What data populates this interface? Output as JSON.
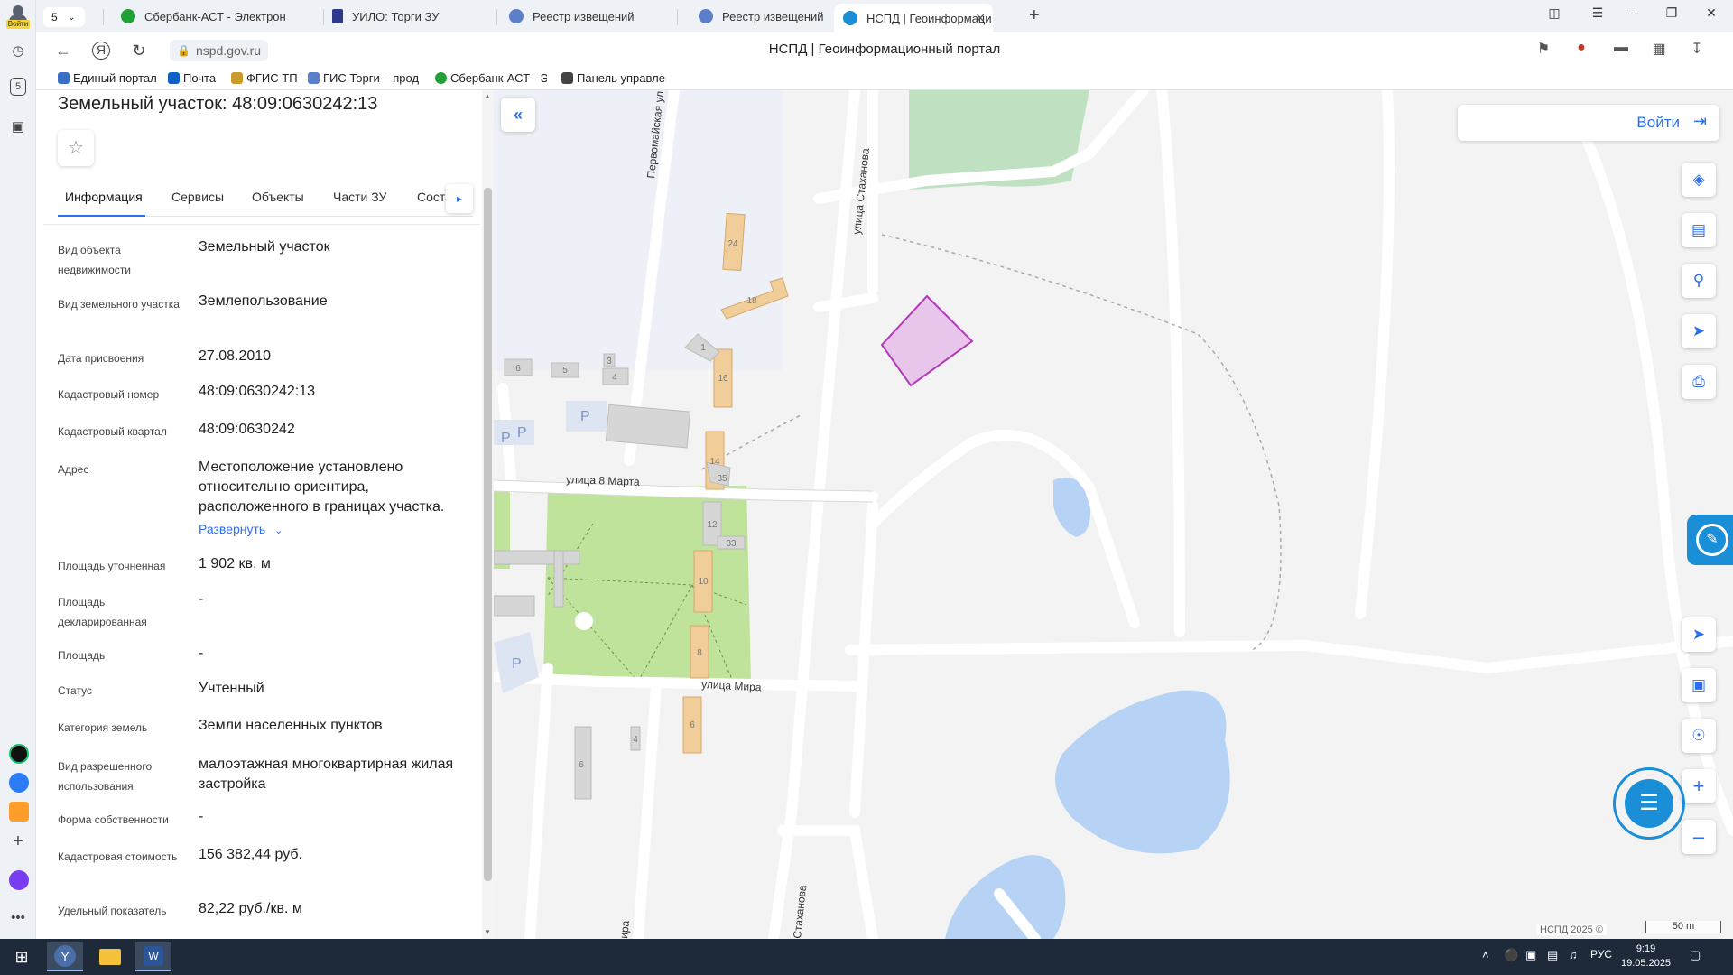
{
  "browser": {
    "profile_badge": "Войти",
    "tab_count": "5",
    "tabs": [
      {
        "title": "Сбербанк-АСТ - Электрон"
      },
      {
        "title": "УИЛО: Торги ЗУ"
      },
      {
        "title": "Реестр извещений"
      },
      {
        "title": "Реестр извещений"
      },
      {
        "title": "НСПД | Геоинформаци"
      }
    ],
    "url": "nspd.gov.ru",
    "page_title": "НСПД | Геоинформационный портал",
    "bookmarks": [
      {
        "label": "Единый портал"
      },
      {
        "label": "Почта"
      },
      {
        "label": "ФГИС ТП"
      },
      {
        "label": "ГИС Торги – прод"
      },
      {
        "label": "Сбербанк-АСТ - Э"
      },
      {
        "label": "Панель управлен"
      }
    ],
    "sidebar_counter": "5"
  },
  "panel": {
    "title": "Земельный участок: 48:09:0630242:13",
    "tabs": [
      "Информация",
      "Сервисы",
      "Объекты",
      "Части ЗУ",
      "Соста"
    ],
    "rows": [
      {
        "label": "Вид объекта недвижимости",
        "value": "Земельный участок"
      },
      {
        "label": "Вид земельного участка",
        "value": "Землепользование"
      },
      {
        "label": "Дата присвоения",
        "value": "27.08.2010"
      },
      {
        "label": "Кадастровый номер",
        "value": "48:09:0630242:13"
      },
      {
        "label": "Кадастровый квартал",
        "value": "48:09:0630242"
      },
      {
        "label": "Адрес",
        "value": "Местоположение установлено относительно ориентира, расположенного в границах участка."
      },
      {
        "label": "Площадь уточненная",
        "value": "1 902 кв. м"
      },
      {
        "label": "Площадь декларированная",
        "value": "-"
      },
      {
        "label": "Площадь",
        "value": "-"
      },
      {
        "label": "Статус",
        "value": "Учтенный"
      },
      {
        "label": "Категория земель",
        "value": "Земли населенных пунктов"
      },
      {
        "label": "Вид разрешенного использования",
        "value": "малоэтажная многоквартирная жилая застройка"
      },
      {
        "label": "Форма собственности",
        "value": "-"
      },
      {
        "label": "Кадастровая стоимость",
        "value": "156 382,44 руб."
      },
      {
        "label": "Удельный показатель",
        "value": "82,22 руб./кв. м"
      }
    ],
    "expand_label": "Развернуть"
  },
  "map": {
    "login_label": "Войти",
    "streets": {
      "pervomayskaya": "Первомайская ул.",
      "stakhanova_top": "улица Стаханова",
      "stakhanova_bottom": "Стаханова",
      "march8": "улица 8 Марта",
      "mira": "улица Мира",
      "mira_partial": "ира"
    },
    "house_numbers": [
      "24",
      "18",
      "16",
      "14",
      "12",
      "10",
      "8",
      "6",
      "1",
      "3",
      "4",
      "5",
      "6",
      "35",
      "33",
      "4",
      "6"
    ],
    "parking_label": "P",
    "attribution": "НСПД 2025 ©",
    "scale_label": "50 m",
    "parcel_color": "#b03ab8"
  },
  "taskbar": {
    "lang": "РУС",
    "time": "9:19",
    "date": "19.05.2025"
  }
}
